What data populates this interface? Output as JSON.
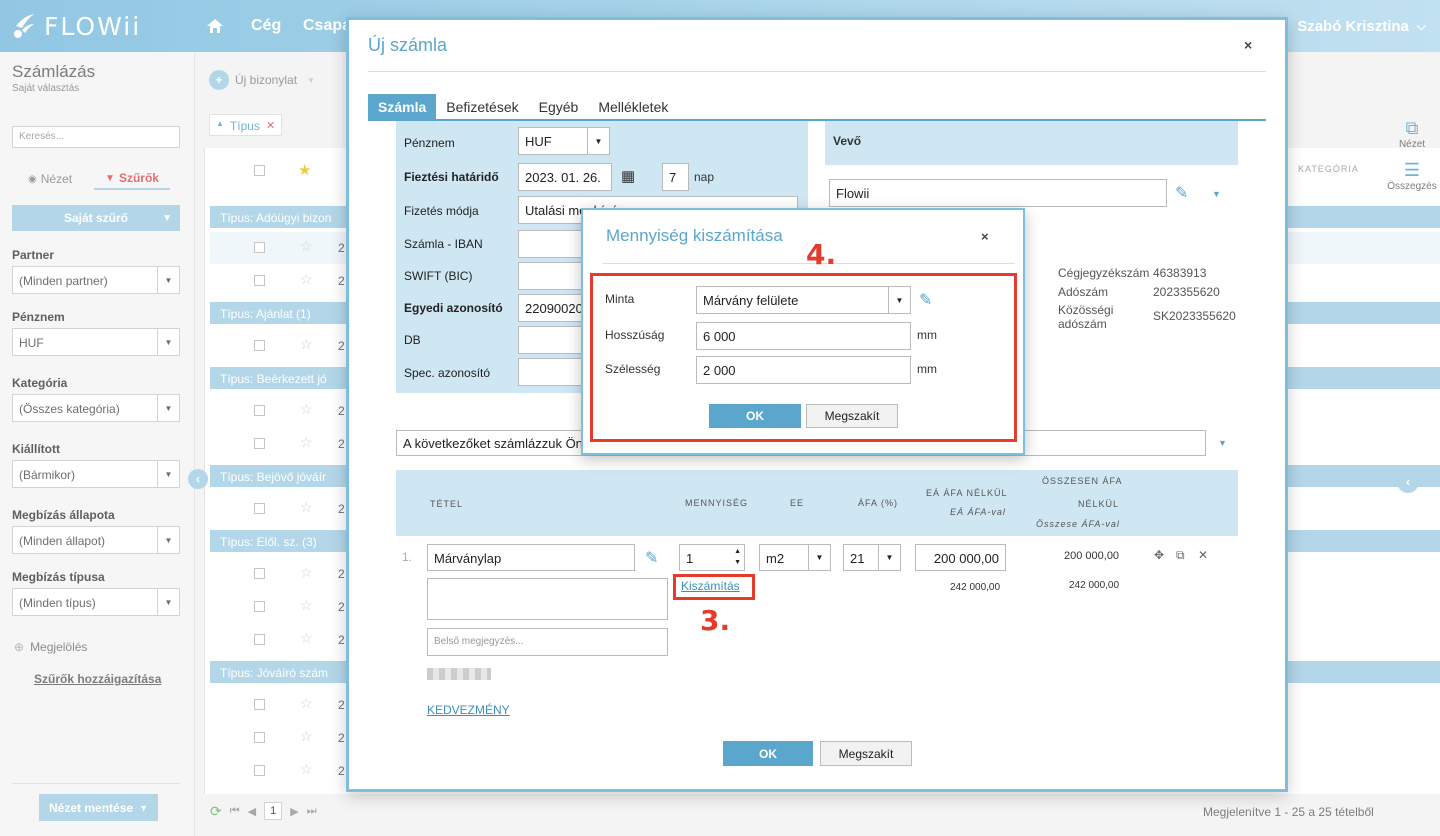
{
  "app": {
    "brand": "FLOWii",
    "user": "Szabó Krisztina"
  },
  "topnav": {
    "items": [
      "Cég",
      "Csapa"
    ]
  },
  "sidebar": {
    "title": "Számlázás",
    "subtitle": "Saját választás",
    "search_placeholder": "Keresés...",
    "tab_view": "Nézet",
    "tab_filters": "Szűrők",
    "own_filter": "Saját szűrő",
    "filters": [
      {
        "label": "Partner",
        "value": "(Minden partner)"
      },
      {
        "label": "Pénznem",
        "value": "HUF"
      },
      {
        "label": "Kategória",
        "value": "(Összes kategória)"
      },
      {
        "label": "Kiállított",
        "value": "(Bármikor)"
      },
      {
        "label": "Megbízás állapota",
        "value": "(Minden állapot)"
      },
      {
        "label": "Megbízás típusa",
        "value": "(Minden típus)"
      }
    ],
    "mark": "Megjelölés",
    "assign_filters": "Szűrők hozzáigazítása",
    "save_view": "Nézet mentése"
  },
  "list": {
    "new_doc": "Új bizonylat",
    "type_chip": "Típus",
    "category_col": "KATEGÓRIA",
    "groups": [
      "Típus: Adóügyi bizon",
      "Típus: Ajánlat (1)",
      "Típus: Beérkezett jó",
      "Típus: Bejövő jóváír",
      "Típus: Elől. sz. (3)",
      "Típus: Jóváíró szám"
    ],
    "row_digit": "2",
    "pager_page": "1",
    "pager_info": "Megjelenítve 1 - 25 a 25 tételből"
  },
  "right_panel": {
    "view": "Nézet",
    "summary": "Összegzés"
  },
  "dialog": {
    "title": "Új számla",
    "close": "×",
    "tabs": [
      "Számla",
      "Befizetések",
      "Egyéb",
      "Mellékletek"
    ],
    "fields": {
      "currency_label": "Pénznem",
      "currency_value": "HUF",
      "due_label": "Fieztési határidő",
      "due_value": "2023. 01. 26.",
      "days_value": "7",
      "days_unit": "nap",
      "payment_label": "Fizetés módja",
      "payment_value": "Utalási megbízás",
      "iban_label": "Számla - IBAN",
      "swift_label": "SWIFT (BIC)",
      "unique_label": "Egyedi azonosító",
      "unique_value": "22090020",
      "db_label": "DB",
      "spec_label": "Spec. azonosító"
    },
    "buyer": {
      "header": "Vevő",
      "name": "Flowii",
      "reg_label": "Cégjegyzékszám",
      "reg_value": "46383913",
      "tax_label": "Adószám",
      "tax_value": "2023355620",
      "eu_tax_label_1": "Közösségi",
      "eu_tax_label_2": "adószám",
      "eu_tax_value": "SK2023355620"
    },
    "note": "A következőket számlázzuk Önne",
    "table_headers": {
      "item": "TÉTEL",
      "qty": "MENNYISÉG",
      "unit": "EE",
      "vat": "ÁFA (%)",
      "unit_net": "EÁ ÁFA NÉLKÜL",
      "unit_gross": "EÁ ÁFA-val",
      "total_net_1": "ÖSSZESEN ÁFA",
      "total_net_2": "NÉLKÜL",
      "total_gross": "Összese ÁFA-val"
    },
    "line": {
      "index": "1.",
      "name": "Márványlap",
      "qty": "1",
      "unit": "m2",
      "vat": "21",
      "unit_price": "200 000,00",
      "unit_gross": "242 000,00",
      "total_net": "200 000,00",
      "total_gross": "242 000,00",
      "calc_link": "Kiszámítás",
      "internal_note_placeholder": "Belső megjegyzés..."
    },
    "discount": "KEDVEZMÉNY",
    "ok": "OK",
    "cancel": "Megszakít"
  },
  "qty_dialog": {
    "title": "Mennyiség kiszámítása",
    "close": "×",
    "pattern_label": "Minta",
    "pattern_value": "Márvány felülete",
    "length_label": "Hosszúság",
    "length_value": "6 000",
    "length_unit": "mm",
    "width_label": "Szélesség",
    "width_value": "2 000",
    "width_unit": "mm",
    "ok": "OK",
    "cancel": "Megszakít"
  },
  "annotations": {
    "step3": "3.",
    "step4": "4."
  },
  "colors": {
    "accent": "#5aa6cc",
    "header": "#a6d1e6",
    "highlight": "#e53b2c"
  }
}
